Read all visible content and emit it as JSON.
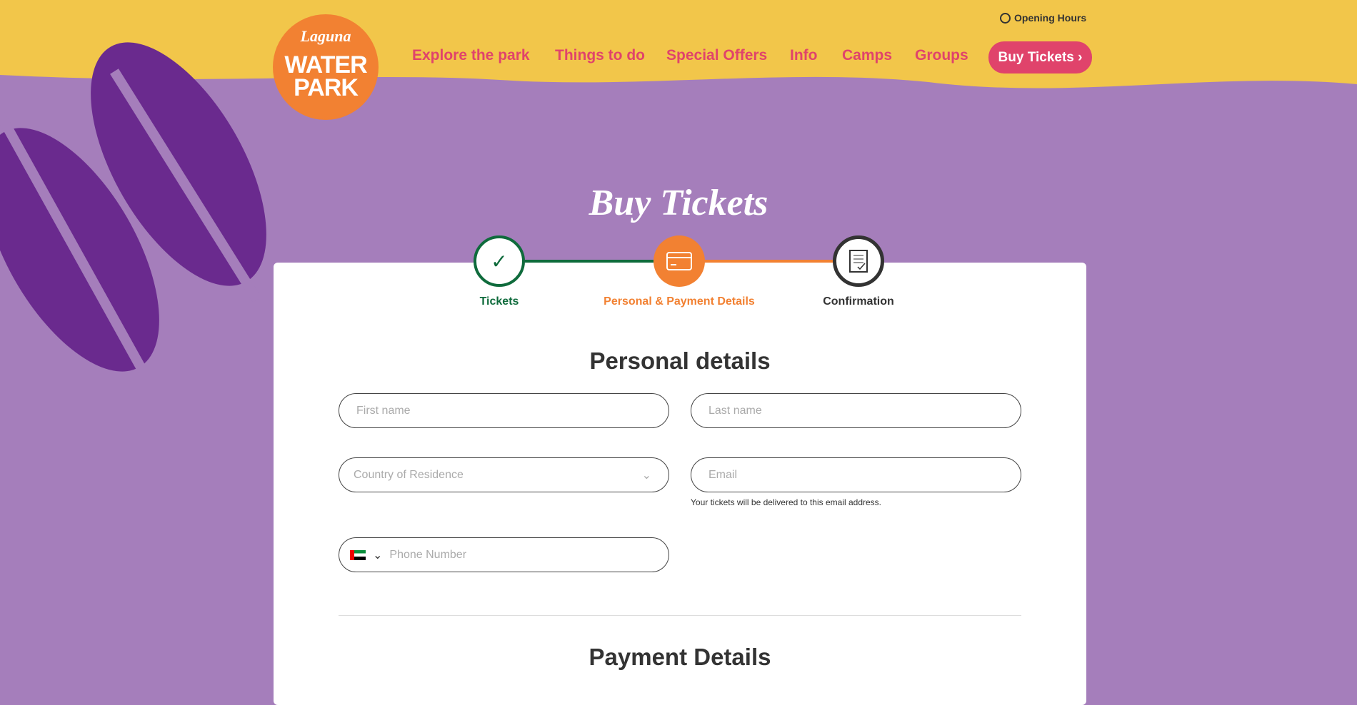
{
  "header": {
    "logo_text": [
      "Laguna",
      "WATER",
      "PARK"
    ],
    "opening_hours": "Opening Hours",
    "nav": [
      "Explore the park",
      "Things to do",
      "Special Offers",
      "Info",
      "Camps",
      "Groups"
    ],
    "buy_button": "Buy Tickets ›"
  },
  "page_title": "Buy Tickets",
  "steps": [
    {
      "label": "Tickets",
      "icon": "check-icon",
      "state": "done"
    },
    {
      "label": "Personal & Payment Details",
      "icon": "credit-card-icon",
      "state": "active"
    },
    {
      "label": "Confirmation",
      "icon": "document-check-icon",
      "state": "pending"
    }
  ],
  "personal": {
    "heading": "Personal details",
    "first_name": "First name",
    "last_name": "Last name",
    "country": "Country of Residence",
    "email": "Email",
    "email_help": "Your tickets will be delivered to this email address.",
    "phone": "Phone Number"
  },
  "payment": {
    "heading": "Payment Details"
  },
  "colors": {
    "yellow": "#f2c64a",
    "purple": "#a57ebb",
    "pink": "#e0436b",
    "orange": "#f28132",
    "green": "#0f6b3c"
  }
}
